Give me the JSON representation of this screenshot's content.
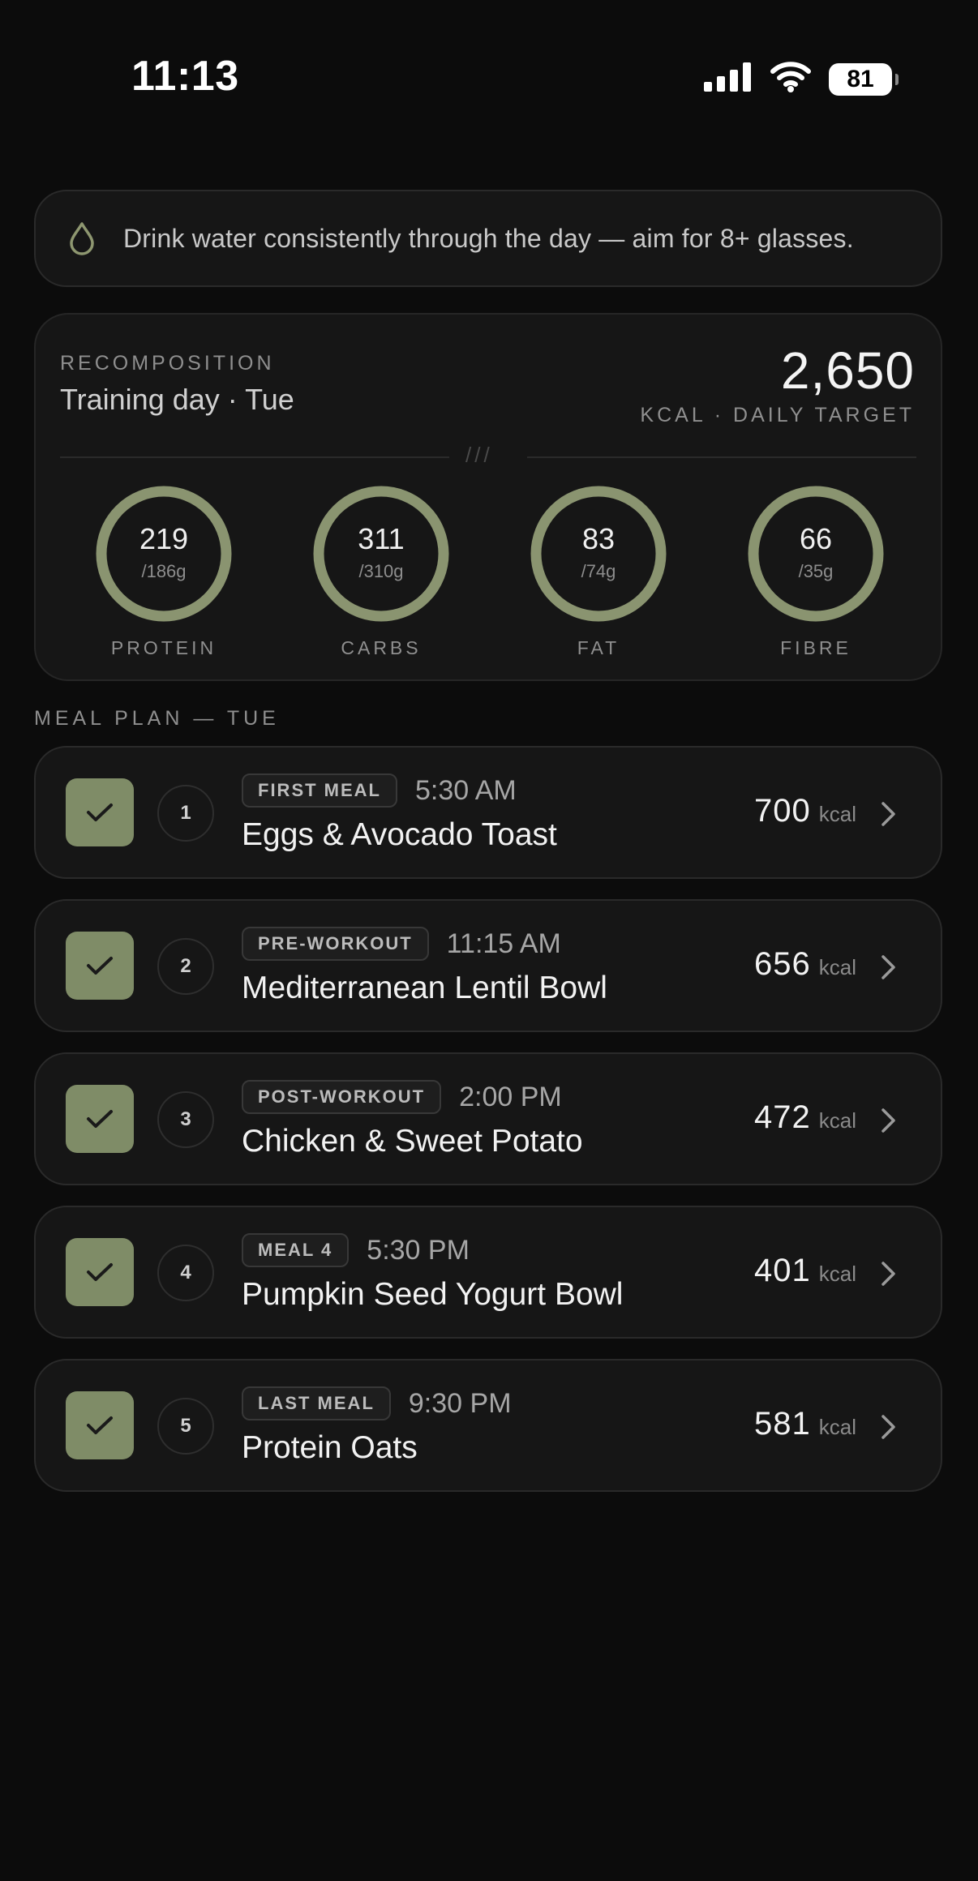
{
  "status_bar": {
    "time": "11:13",
    "battery": "81"
  },
  "tip": {
    "icon": "water-drop-icon",
    "text": "Drink water consistently through the day — aim for 8+ glasses."
  },
  "targets": {
    "program": "RECOMPOSITION",
    "day": "Training day · Tue",
    "kcal": "2,650",
    "kcal_label": "KCAL · DAILY TARGET",
    "divider_mark": "///",
    "macros": [
      {
        "value": "219",
        "target": "/186g",
        "label": "PROTEIN",
        "progress": 1.0
      },
      {
        "value": "311",
        "target": "/310g",
        "label": "CARBS",
        "progress": 1.0
      },
      {
        "value": "83",
        "target": "/74g",
        "label": "FAT",
        "progress": 1.0
      },
      {
        "value": "66",
        "target": "/35g",
        "label": "FIBRE",
        "progress": 1.0
      }
    ]
  },
  "meal_plan": {
    "heading": "MEAL PLAN — TUE",
    "meals": [
      {
        "num": "1",
        "tag": "FIRST MEAL",
        "time": "5:30 AM",
        "name": "Eggs & Avocado Toast",
        "kcal": "700",
        "unit": "kcal",
        "checked": true
      },
      {
        "num": "2",
        "tag": "PRE-WORKOUT",
        "time": "11:15 AM",
        "name": "Mediterranean Lentil Bowl",
        "kcal": "656",
        "unit": "kcal",
        "checked": true
      },
      {
        "num": "3",
        "tag": "POST-WORKOUT",
        "time": "2:00 PM",
        "name": "Chicken & Sweet Potato",
        "kcal": "472",
        "unit": "kcal",
        "checked": true
      },
      {
        "num": "4",
        "tag": "MEAL 4",
        "time": "5:30 PM",
        "name": "Pumpkin Seed Yogurt Bowl",
        "kcal": "401",
        "unit": "kcal",
        "checked": true
      },
      {
        "num": "5",
        "tag": "LAST MEAL",
        "time": "9:30 PM",
        "name": "Protein Oats",
        "kcal": "581",
        "unit": "kcal",
        "checked": true
      }
    ]
  },
  "colors": {
    "accent": "#7f8c67",
    "background": "#0c0c0c",
    "card": "#161616"
  }
}
